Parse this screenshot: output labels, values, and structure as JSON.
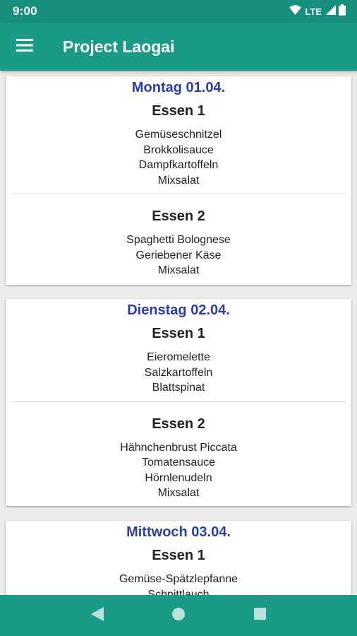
{
  "status_bar": {
    "time": "9:00",
    "network": "LTE",
    "icons": [
      "wifi-icon",
      "cell-signal-icon",
      "battery-icon"
    ]
  },
  "app_bar": {
    "title": "Project Laogai",
    "menu_icon": "hamburger-menu-icon"
  },
  "colors": {
    "app_bar": "#1a9b87",
    "status_bar": "#168f7e",
    "day_title": "#2b3ea8"
  },
  "days": [
    {
      "title": "Montag 01.04.",
      "meals": [
        {
          "title": "Essen 1",
          "items": [
            "Gemüseschnitzel",
            "Brokkolisauce",
            "Dampfkartoffeln",
            "Mixsalat"
          ]
        },
        {
          "title": "Essen 2",
          "items": [
            "Spaghetti Bolognese",
            "Geriebener Käse",
            "Mixsalat"
          ]
        }
      ]
    },
    {
      "title": "Dienstag 02.04.",
      "meals": [
        {
          "title": "Essen 1",
          "items": [
            "Eieromelette",
            "Salzkartoffeln",
            "Blattspinat"
          ]
        },
        {
          "title": "Essen 2",
          "items": [
            "Hähnchenbrust Piccata",
            "Tomatensauce",
            "Hörnlenudeln",
            "Mixsalat"
          ]
        }
      ]
    },
    {
      "title": "Mittwoch 03.04.",
      "meals": [
        {
          "title": "Essen 1",
          "items": [
            "Gemüse-Spätzlepfanne",
            "Schnittlauch"
          ]
        }
      ]
    }
  ],
  "nav_bar": {
    "buttons": [
      "back-icon",
      "home-icon",
      "recents-icon"
    ]
  }
}
